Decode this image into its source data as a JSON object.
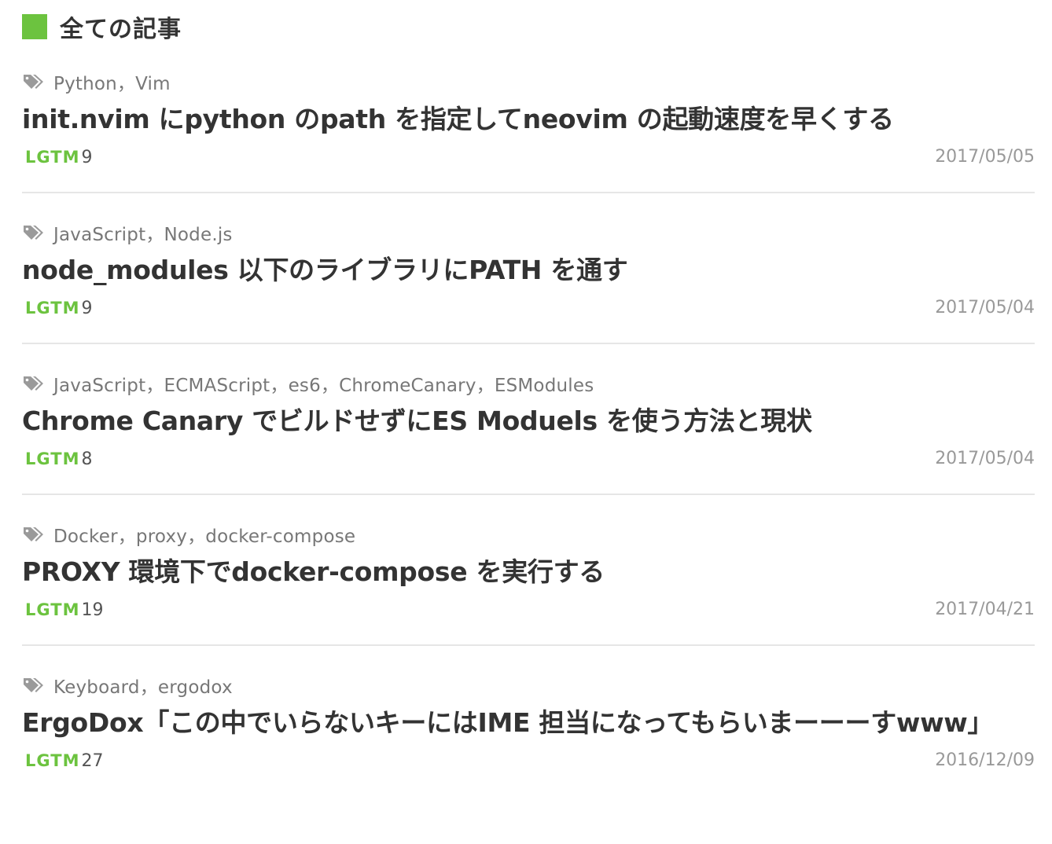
{
  "section": {
    "title": "全ての記事"
  },
  "colors": {
    "accent": "#6cc33f",
    "text": "#333333",
    "muted": "#777777",
    "date": "#999999",
    "divider": "#e6e6e6"
  },
  "icons": {
    "tag": "tag-icon"
  },
  "articles": [
    {
      "tags": "Python，Vim",
      "title": "init.nvim にpython のpath を指定してneovim の起動速度を早くする",
      "lgtm_label": "LGTM",
      "lgtm_count": "9",
      "date": "2017/05/05"
    },
    {
      "tags": "JavaScript，Node.js",
      "title": "node_modules 以下のライブラリにPATH を通す",
      "lgtm_label": "LGTM",
      "lgtm_count": "9",
      "date": "2017/05/04"
    },
    {
      "tags": "JavaScript，ECMAScript，es6，ChromeCanary，ESModules",
      "title": "Chrome Canary でビルドせずにES Moduels を使う方法と現状",
      "lgtm_label": "LGTM",
      "lgtm_count": "8",
      "date": "2017/05/04"
    },
    {
      "tags": "Docker，proxy，docker-compose",
      "title": "PROXY 環境下でdocker-compose を実行する",
      "lgtm_label": "LGTM",
      "lgtm_count": "19",
      "date": "2017/04/21"
    },
    {
      "tags": "Keyboard，ergodox",
      "title": "ErgoDox「この中でいらないキーにはIME 担当になってもらいまーーーすwww」",
      "lgtm_label": "LGTM",
      "lgtm_count": "27",
      "date": "2016/12/09"
    }
  ]
}
